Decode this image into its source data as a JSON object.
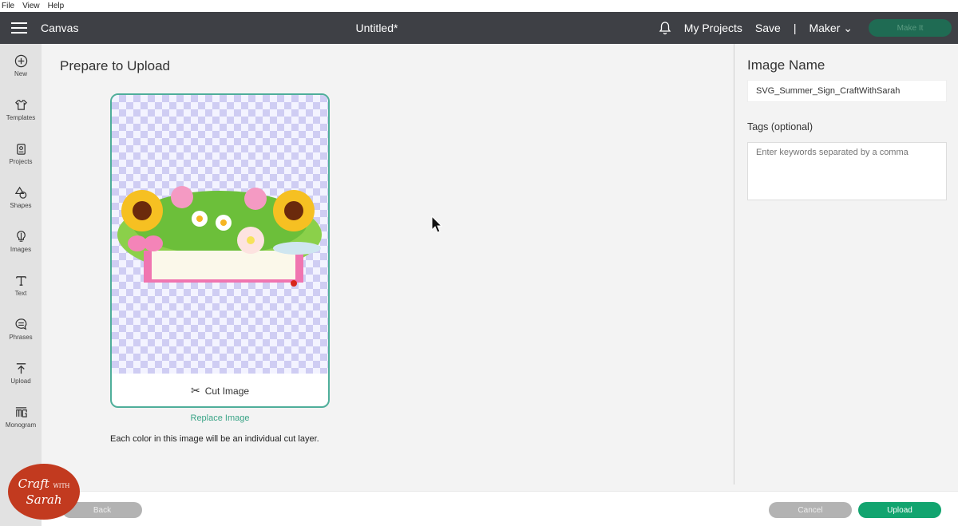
{
  "menubar": {
    "items": [
      "File",
      "View",
      "Help"
    ]
  },
  "topbar": {
    "app_title": "Canvas",
    "document_title": "Untitled*",
    "my_projects": "My Projects",
    "save": "Save",
    "separator": "|",
    "machine": "Maker",
    "make_it": "Make It"
  },
  "sidebar": {
    "items": [
      {
        "label": "New",
        "icon": "plus-circle-icon"
      },
      {
        "label": "Templates",
        "icon": "tshirt-icon"
      },
      {
        "label": "Projects",
        "icon": "projects-icon"
      },
      {
        "label": "Shapes",
        "icon": "shapes-icon"
      },
      {
        "label": "Images",
        "icon": "lightbulb-icon"
      },
      {
        "label": "Text",
        "icon": "text-icon"
      },
      {
        "label": "Phrases",
        "icon": "speech-bubble-icon"
      },
      {
        "label": "Upload",
        "icon": "upload-icon"
      },
      {
        "label": "Monogram",
        "icon": "monogram-icon"
      }
    ]
  },
  "main": {
    "title": "Prepare to Upload",
    "cut_image_label": "Cut Image",
    "replace_image": "Replace Image",
    "note": "Each color in this image will be an individual cut layer."
  },
  "panel": {
    "image_name_label": "Image Name",
    "image_name_value": "SVG_Summer_Sign_CraftWithSarah",
    "tags_label": "Tags (optional)",
    "tags_placeholder": "Enter keywords separated by a comma"
  },
  "footer": {
    "back": "Back",
    "cancel": "Cancel",
    "upload": "Upload"
  },
  "watermark": {
    "line1": "Craft",
    "with": "WITH",
    "line2": "Sarah"
  },
  "colors": {
    "accent": "#12a46f",
    "topbar": "#3e4045",
    "card_border": "#4fae9a"
  }
}
